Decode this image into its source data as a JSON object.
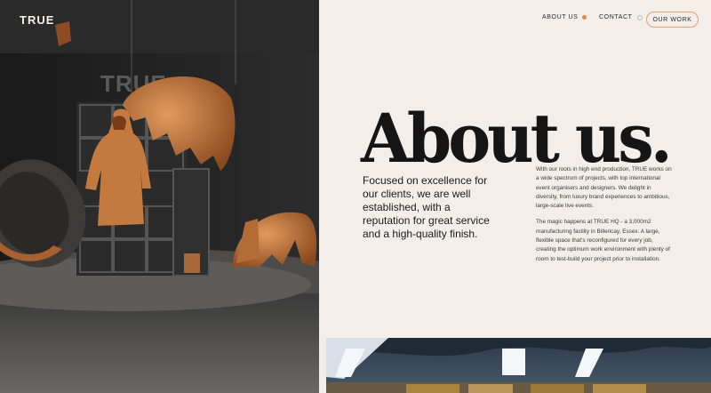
{
  "brand": {
    "logo": "TRUE",
    "sign_text": "TRUE"
  },
  "nav": {
    "items": [
      {
        "label": "ABOUT US",
        "indicator": "active-dot"
      },
      {
        "label": "CONTACT",
        "indicator": "empty-dot"
      }
    ],
    "cta_label": "OUR WORK"
  },
  "about": {
    "title": "About us.",
    "lead": "Focused on excellence for our clients, we are well established, with a reputation for great service and a high-quality finish.",
    "paragraphs": [
      "With our roots in high end production, TRUE works on a wide spectrum of projects, with top international event organisers and designers. We delight in diversity, from luxury brand experiences to ambitious, large-scale live events.",
      "The magic happens at TRUE HQ - a 3,000m2 manufacturing facility in Billericay, Essex. A large, flexible space that's reconfigured for every job, creating the optimum work environment with plenty of room to test-build your project prior to installation."
    ]
  },
  "colors": {
    "accent": "#e08c43",
    "background": "#f3eee9",
    "text": "#151515",
    "copper": "#c47a3e"
  }
}
